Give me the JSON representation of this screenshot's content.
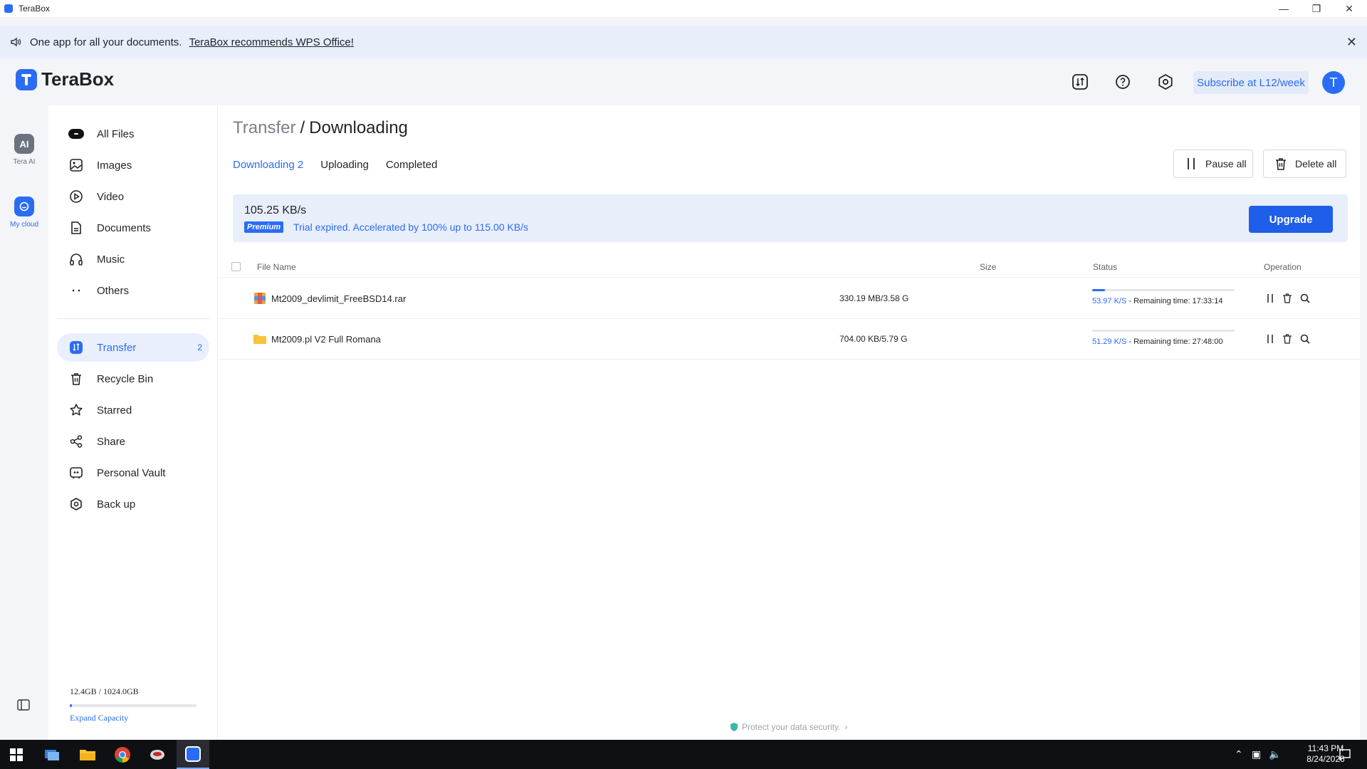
{
  "window": {
    "title": "TeraBox"
  },
  "banner": {
    "message": "One app for all your documents.",
    "link": "TeraBox recommends WPS Office!"
  },
  "header": {
    "logo_text": "TeraBox",
    "subscribe_label": "Subscribe at L12/week",
    "avatar_initial": "T",
    "icons": [
      "transfer-icon",
      "help-icon",
      "settings-icon"
    ]
  },
  "rail": {
    "items": [
      {
        "label": "Tera AI",
        "icon_text": "AI"
      },
      {
        "label": "My cloud"
      }
    ]
  },
  "sidebar": {
    "items": [
      {
        "label": "All Files",
        "icon": "all-files-icon"
      },
      {
        "label": "Images",
        "icon": "images-icon"
      },
      {
        "label": "Video",
        "icon": "video-icon"
      },
      {
        "label": "Documents",
        "icon": "documents-icon"
      },
      {
        "label": "Music",
        "icon": "music-icon"
      },
      {
        "label": "Others",
        "icon": "others-icon"
      },
      {
        "label": "Transfer",
        "icon": "transfer-icon",
        "count": "2",
        "active": true
      },
      {
        "label": "Recycle Bin",
        "icon": "recycle-bin-icon"
      },
      {
        "label": "Starred",
        "icon": "star-icon"
      },
      {
        "label": "Share",
        "icon": "share-icon"
      },
      {
        "label": "Personal Vault",
        "icon": "vault-icon"
      },
      {
        "label": "Back up",
        "icon": "backup-icon"
      }
    ],
    "storage": {
      "used_text": "12.4GB / 1024.0GB",
      "fraction": 0.012,
      "expand_label": "Expand Capacity"
    }
  },
  "main": {
    "breadcrumb": {
      "parent": "Transfer",
      "separator": "/",
      "current": "Downloading"
    },
    "tabs": [
      {
        "label": "Downloading 2",
        "active": true
      },
      {
        "label": "Uploading"
      },
      {
        "label": "Completed"
      }
    ],
    "buttons": {
      "pause_all": "Pause all",
      "delete_all": "Delete all"
    },
    "speed": {
      "value": "105.25 KB/s",
      "badge": "Premium",
      "note": "Trial expired. Accelerated by 100% up to 115.00 KB/s",
      "upgrade_label": "Upgrade"
    },
    "table": {
      "headers": {
        "name": "File Name",
        "size": "Size",
        "status": "Status",
        "operation": "Operation"
      },
      "rows": [
        {
          "icon": "rar-archive-icon",
          "name": "Mt2009_devlimit_FreeBSD14.rar",
          "size": "330.19 MB/3.58 G",
          "progress": 0.09,
          "rate": "53.97 K/S",
          "remaining": " - Remaining time: 17:33:14"
        },
        {
          "icon": "folder-icon",
          "name": "Mt2009.pl V2 Full Romana",
          "size": "704.00 KB/5.79 G",
          "progress": 0.0,
          "rate": "51.29 K/S",
          "remaining": " - Remaining time: 27:48:00"
        }
      ]
    },
    "footer_note": "Protect your data security."
  },
  "taskbar": {
    "time": "11:43 PM",
    "date": "8/24/2026"
  },
  "colors": {
    "accent": "#2a6df4",
    "banner_bg": "#e9eefb",
    "upgrade_bg": "#1e5ee8"
  }
}
